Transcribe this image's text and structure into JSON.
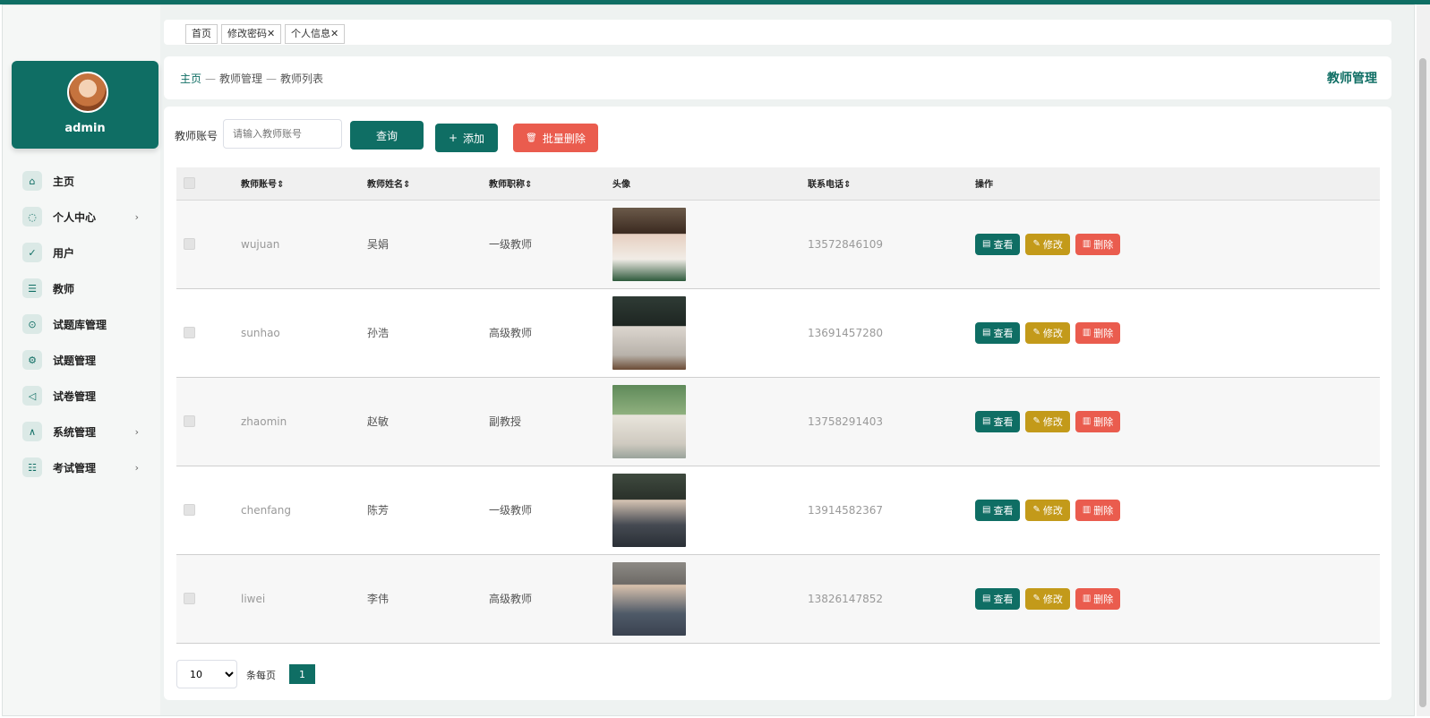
{
  "sidebar": {
    "username": "admin",
    "items": [
      {
        "label": "主页",
        "icon": "⌂",
        "arrow": ""
      },
      {
        "label": "个人中心",
        "icon": "◌",
        "arrow": "›"
      },
      {
        "label": "用户",
        "icon": "✓",
        "arrow": ""
      },
      {
        "label": "教师",
        "icon": "☰",
        "arrow": ""
      },
      {
        "label": "试题库管理",
        "icon": "⊙",
        "arrow": ""
      },
      {
        "label": "试题管理",
        "icon": "⚙",
        "arrow": ""
      },
      {
        "label": "试卷管理",
        "icon": "◁",
        "arrow": ""
      },
      {
        "label": "系统管理",
        "icon": "∧",
        "arrow": "›"
      },
      {
        "label": "考试管理",
        "icon": "☷",
        "arrow": "›"
      }
    ]
  },
  "tabs": [
    {
      "label": "首页"
    },
    {
      "label": "修改密码✕"
    },
    {
      "label": "个人信息✕"
    }
  ],
  "breadcrumb": {
    "home": "主页",
    "sep": "—",
    "level2": "教师管理",
    "level3": "教师列表"
  },
  "page_title": "教师管理",
  "search": {
    "label": "教师账号",
    "placeholder": "请输入教师账号",
    "query_label": "查询",
    "add_label": "添加",
    "add_icon": "+",
    "batch_delete_label": "批量删除",
    "batch_delete_icon": "🗑"
  },
  "table": {
    "headers": [
      "教师账号",
      "教师姓名",
      "教师职称",
      "头像",
      "联系电话",
      "操作"
    ],
    "rows": [
      {
        "account": "wujuan",
        "name": "吴娟",
        "title": "一级教师",
        "phone": "13572846109"
      },
      {
        "account": "sunhao",
        "name": "孙浩",
        "title": "高级教师",
        "phone": "13691457280"
      },
      {
        "account": "zhaomin",
        "name": "赵敏",
        "title": "副教授",
        "phone": "13758291403"
      },
      {
        "account": "chenfang",
        "name": "陈芳",
        "title": "一级教师",
        "phone": "13914582367"
      },
      {
        "account": "liwei",
        "name": "李伟",
        "title": "高级教师",
        "phone": "13826147852"
      }
    ],
    "actions": {
      "view": "查看",
      "edit": "修改",
      "delete": "删除"
    }
  },
  "pager": {
    "page_size": "10",
    "page_size_label": "条每页",
    "current_page": "1"
  }
}
